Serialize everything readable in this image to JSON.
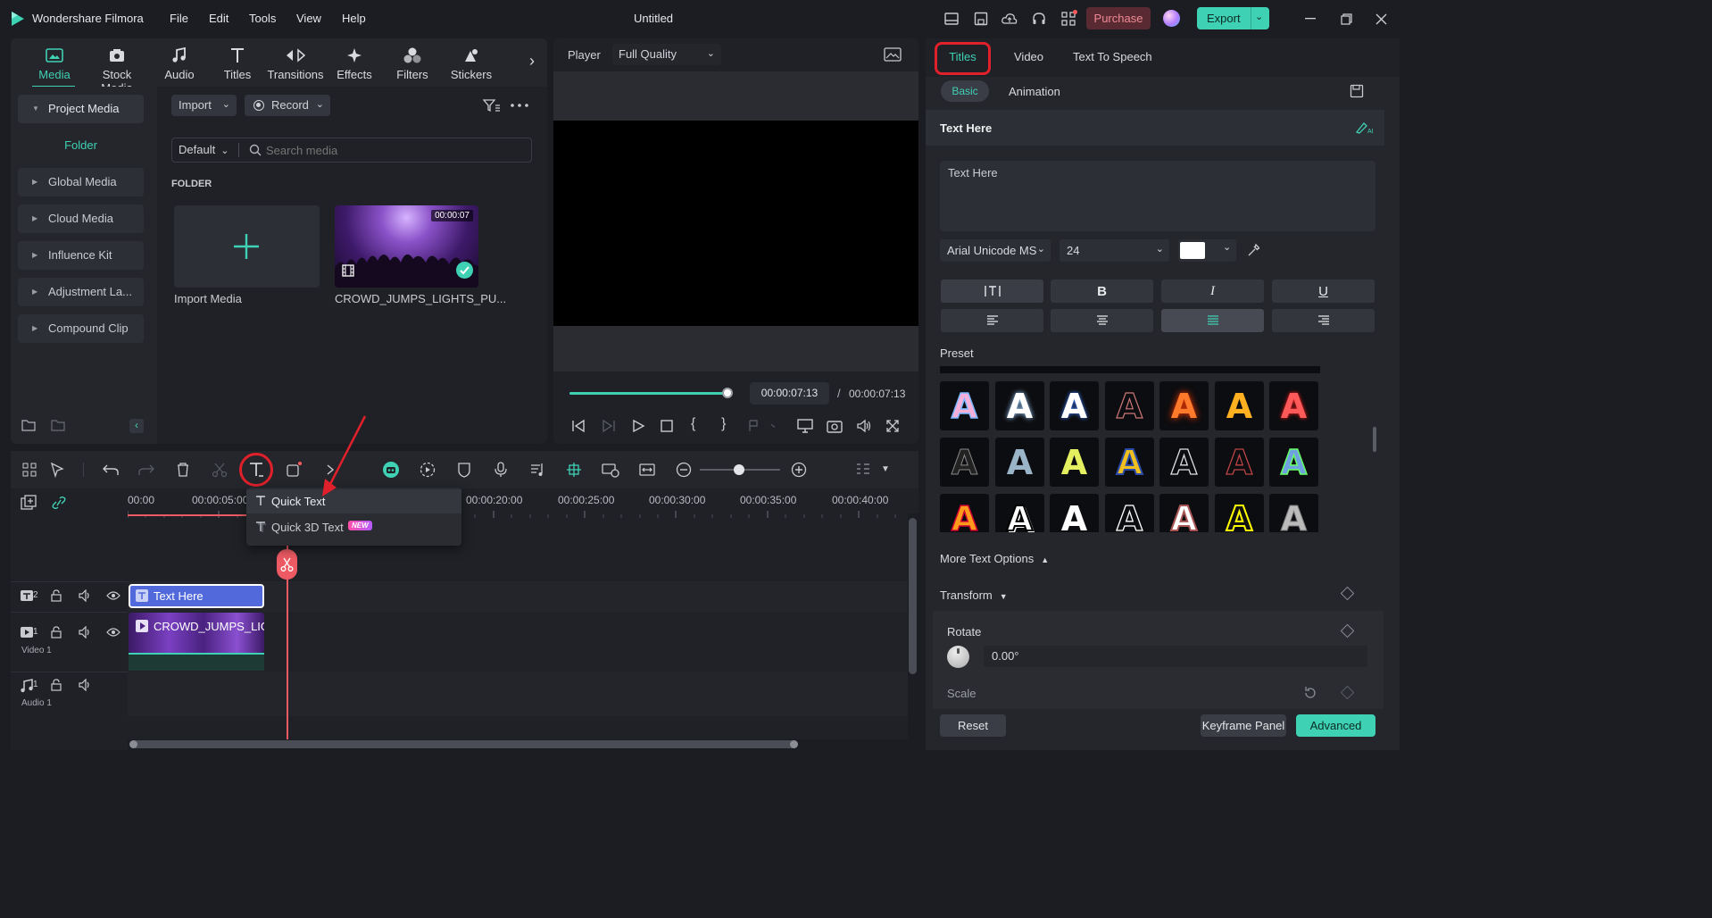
{
  "app": {
    "name": "Wondershare Filmora",
    "doc_title": "Untitled"
  },
  "menu": [
    "File",
    "Edit",
    "Tools",
    "View",
    "Help"
  ],
  "top_right": {
    "purchase": "Purchase",
    "export": "Export"
  },
  "media_tabs": [
    {
      "label": "Media",
      "icon": "media-icon"
    },
    {
      "label": "Stock Media",
      "icon": "stock-media-icon"
    },
    {
      "label": "Audio",
      "icon": "music-note-icon"
    },
    {
      "label": "Titles",
      "icon": "text-t-icon"
    },
    {
      "label": "Transitions",
      "icon": "transitions-icon"
    },
    {
      "label": "Effects",
      "icon": "effects-sparkle-icon"
    },
    {
      "label": "Filters",
      "icon": "filters-icon"
    },
    {
      "label": "Stickers",
      "icon": "stickers-icon"
    }
  ],
  "sidebar": {
    "project_media": "Project Media",
    "folder": "Folder",
    "items": [
      "Global Media",
      "Cloud Media",
      "Influence Kit",
      "Adjustment La...",
      "Compound Clip"
    ]
  },
  "media_toolbar": {
    "import": "Import",
    "record": "Record",
    "sort": "Default",
    "search_placeholder": "Search media"
  },
  "folder_label": "FOLDER",
  "media_items": [
    {
      "name": "Import Media"
    },
    {
      "name": "CROWD_JUMPS_LIGHTS_PU...",
      "duration": "00:00:07"
    }
  ],
  "player": {
    "label": "Player",
    "quality": "Full Quality",
    "current_time": "00:00:07:13",
    "separator": "/",
    "total_time": "00:00:07:13",
    "progress": 1.0
  },
  "timeline": {
    "ruler": [
      "00:00",
      "00:00:05:00",
      "00:00:20:00",
      "00:00:25:00",
      "00:00:30:00",
      "00:00:35:00",
      "00:00:40:00"
    ],
    "dropdown": {
      "quick_text": "Quick Text",
      "quick_3d_text": "Quick 3D Text",
      "new_badge": "NEW"
    },
    "tracks": [
      {
        "num": "2",
        "label": "",
        "clip": "Text Here"
      },
      {
        "num": "1",
        "label": "Video 1",
        "clip": "CROWD_JUMPS_LIG..."
      },
      {
        "num": "1",
        "label": "Audio 1",
        "clip": ""
      }
    ]
  },
  "right_panel": {
    "tabs": [
      "Titles",
      "Video",
      "Text To Speech"
    ],
    "subtabs": [
      "Basic",
      "Animation"
    ],
    "section_title": "Text Here",
    "text_value": "Text Here",
    "font": "Arial Unicode MS",
    "size": "24",
    "text_color": "#ffffff",
    "preset_label": "Preset",
    "more_text_options": "More Text Options",
    "transform": "Transform",
    "rotate": "Rotate",
    "rotate_value": "0.00°",
    "scale": "Scale",
    "reset": "Reset",
    "keyframe_panel": "Keyframe Panel",
    "advanced": "Advanced"
  },
  "colors": {
    "accent": "#3fd1b4",
    "highlight_red": "#e0202a",
    "purchase_bg": "#5a2a33",
    "clip_blue": "#5269dc"
  }
}
